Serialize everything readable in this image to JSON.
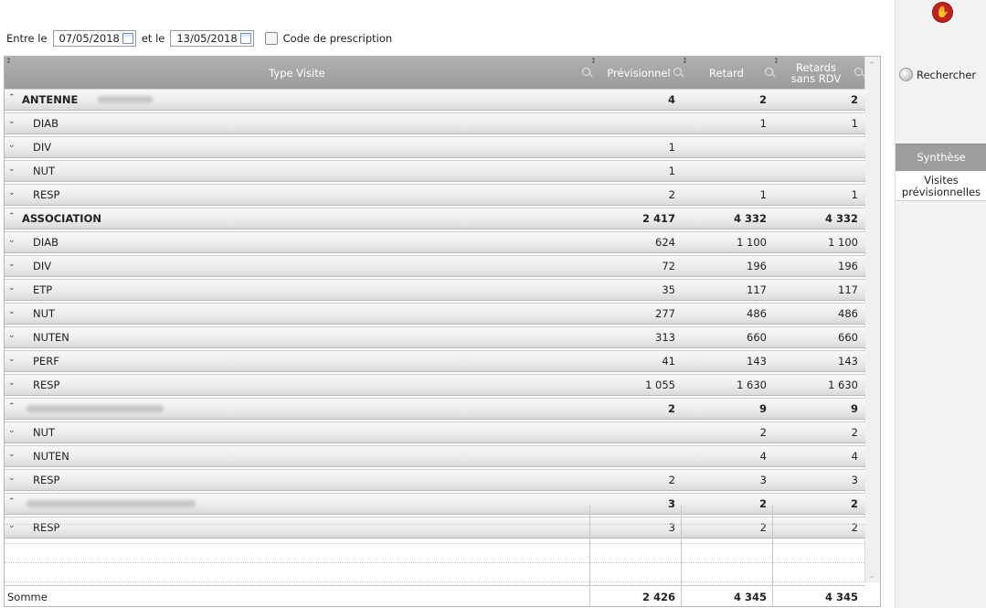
{
  "filter": {
    "between_label": "Entre le",
    "date_from": "07/05/2018",
    "and_label": "et le",
    "date_to": "13/05/2018",
    "prescription_label": "Code de prescription",
    "prescription_checked": false
  },
  "grid": {
    "columns": [
      "Type Visite",
      "Prévisionnel",
      "Retard",
      "Retards sans RDV"
    ],
    "rows": [
      {
        "kind": "group",
        "label": "ANTENNE",
        "blurred": true,
        "prev": "4",
        "retard": "2",
        "sans": "2"
      },
      {
        "kind": "item",
        "label": "DIAB",
        "prev": "",
        "retard": "1",
        "sans": "1"
      },
      {
        "kind": "item",
        "label": "DIV",
        "prev": "1",
        "retard": "",
        "sans": ""
      },
      {
        "kind": "item",
        "label": "NUT",
        "prev": "1",
        "retard": "",
        "sans": ""
      },
      {
        "kind": "item",
        "label": "RESP",
        "prev": "2",
        "retard": "1",
        "sans": "1"
      },
      {
        "kind": "group",
        "label": "ASSOCIATION",
        "blurred": false,
        "prev": "2 417",
        "retard": "4 332",
        "sans": "4 332"
      },
      {
        "kind": "item",
        "label": "DIAB",
        "prev": "624",
        "retard": "1 100",
        "sans": "1 100"
      },
      {
        "kind": "item",
        "label": "DIV",
        "prev": "72",
        "retard": "196",
        "sans": "196"
      },
      {
        "kind": "item",
        "label": "ETP",
        "prev": "35",
        "retard": "117",
        "sans": "117"
      },
      {
        "kind": "item",
        "label": "NUT",
        "prev": "277",
        "retard": "486",
        "sans": "486"
      },
      {
        "kind": "item",
        "label": "NUTEN",
        "prev": "313",
        "retard": "660",
        "sans": "660"
      },
      {
        "kind": "item",
        "label": "PERF",
        "prev": "41",
        "retard": "143",
        "sans": "143"
      },
      {
        "kind": "item",
        "label": "RESP",
        "prev": "1 055",
        "retard": "1 630",
        "sans": "1 630"
      },
      {
        "kind": "group",
        "label": "",
        "blurred": true,
        "prev": "2",
        "retard": "9",
        "sans": "9"
      },
      {
        "kind": "item",
        "label": "NUT",
        "prev": "",
        "retard": "2",
        "sans": "2"
      },
      {
        "kind": "item",
        "label": "NUTEN",
        "prev": "",
        "retard": "4",
        "sans": "4"
      },
      {
        "kind": "item",
        "label": "RESP",
        "prev": "2",
        "retard": "3",
        "sans": "3"
      },
      {
        "kind": "group",
        "label": "",
        "blurred": true,
        "prev": "3",
        "retard": "2",
        "sans": "2"
      },
      {
        "kind": "item",
        "label": "RESP",
        "prev": "3",
        "retard": "2",
        "sans": "2"
      }
    ],
    "footer": {
      "label": "Somme",
      "prev": "2 426",
      "retard": "4 345",
      "sans": "4 345"
    }
  },
  "side": {
    "search_label": "Rechercher",
    "tab_synthese": "Synthèse",
    "tab_visites": "Visites prévisionnelles"
  },
  "colors": {
    "header_bg": "#a3a3a3",
    "active_tab": "#9e9e9e",
    "stop_icon": "#c02020"
  }
}
